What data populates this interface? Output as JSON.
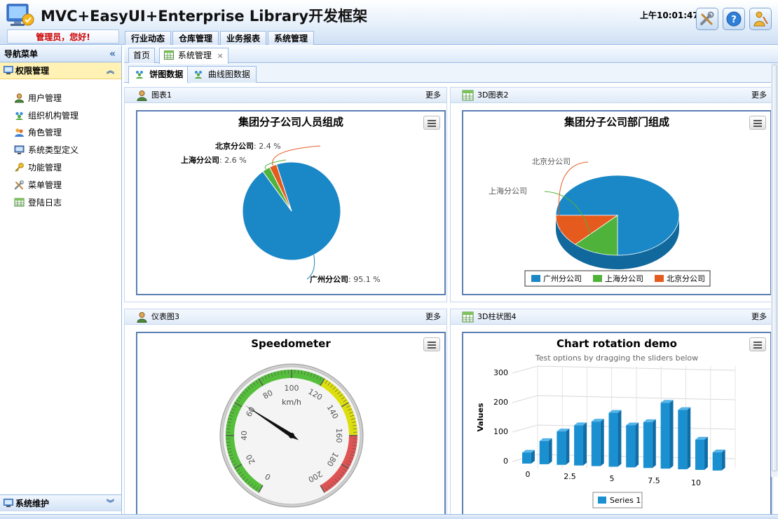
{
  "app": {
    "title": "MVC+EasyUI+Enterprise Library开发框架",
    "clock": "上午10:01:47",
    "welcome": "管理员，您好!",
    "header_buttons": [
      "tools-icon",
      "help-icon",
      "logout-icon"
    ]
  },
  "top_menu": [
    "行业动态",
    "仓库管理",
    "业务报表",
    "系统管理"
  ],
  "sidebar": {
    "title": "导航菜单",
    "collapse_icon": "double-chevron-left-icon",
    "group_open": "权限管理",
    "items": [
      {
        "label": "用户管理",
        "icon": "user-icon"
      },
      {
        "label": "组织机构管理",
        "icon": "org-icon"
      },
      {
        "label": "角色管理",
        "icon": "role-icon"
      },
      {
        "label": "系统类型定义",
        "icon": "monitor-icon"
      },
      {
        "label": "功能管理",
        "icon": "key-icon"
      },
      {
        "label": "菜单管理",
        "icon": "tools-icon"
      },
      {
        "label": "登陆日志",
        "icon": "table-icon"
      }
    ],
    "group_closed": "系统维护"
  },
  "tabs": {
    "page_tabs": [
      {
        "label": "首页"
      },
      {
        "label": "系统管理",
        "closable": true
      }
    ],
    "inner_tabs": [
      "饼图数据",
      "曲线图数据"
    ]
  },
  "panels": [
    {
      "title": "图表1",
      "more": "更多",
      "icon": "user-icon"
    },
    {
      "title": "3D图表2",
      "more": "更多",
      "icon": "table-icon"
    },
    {
      "title": "仪表图3",
      "more": "更多",
      "icon": "user-icon"
    },
    {
      "title": "3D柱状图4",
      "more": "更多",
      "icon": "table-icon"
    }
  ],
  "colors": {
    "blue": "#1a87c7",
    "green": "#4eb23b",
    "orange": "#e55b1e",
    "header_border": "#99bbe8",
    "accent_red": "#cc0000"
  },
  "chart_data": [
    {
      "type": "pie",
      "title": "集团分子公司人员组成",
      "series": [
        {
          "values": [
            {
              "label": "广州分公司",
              "value": 95.1
            },
            {
              "label": "上海分公司",
              "value": 2.6
            },
            {
              "label": "北京分公司",
              "value": 2.4
            }
          ]
        }
      ],
      "value_suffix": " %"
    },
    {
      "type": "pie",
      "title": "集团分子公司部门组成",
      "three_d": true,
      "categories": [
        "广州分公司",
        "上海分公司",
        "北京分公司"
      ],
      "values": [
        75,
        12,
        13
      ],
      "legend": [
        "广州分公司",
        "上海分公司",
        "北京分公司"
      ],
      "legend_position": "bottom"
    },
    {
      "type": "gauge",
      "title": "Speedometer",
      "unit": "km/h",
      "min": 0,
      "max": 200,
      "ticks": [
        0,
        20,
        40,
        60,
        80,
        100,
        120,
        140,
        160,
        180,
        200
      ],
      "value": 62,
      "bands": [
        {
          "from": 0,
          "to": 120,
          "color": "#55BF3B"
        },
        {
          "from": 120,
          "to": 160,
          "color": "#DDDF0D"
        },
        {
          "from": 160,
          "to": 200,
          "color": "#DF5353"
        }
      ]
    },
    {
      "type": "bar",
      "title": "Chart rotation demo",
      "subtitle": "Test options by dragging the sliders below",
      "three_d": true,
      "ylabel": "Values",
      "ylim": [
        0,
        300
      ],
      "yticks": [
        0,
        100,
        200,
        300
      ],
      "xticks": [
        "0",
        "2.5",
        "5",
        "7.5",
        "10"
      ],
      "series": [
        {
          "name": "Series 1",
          "values": [
            29.9,
            71.5,
            106.4,
            129.2,
            144.0,
            176.0,
            135.6,
            148.5,
            216.4,
            194.1,
            95.6,
            54.4
          ]
        }
      ]
    }
  ]
}
